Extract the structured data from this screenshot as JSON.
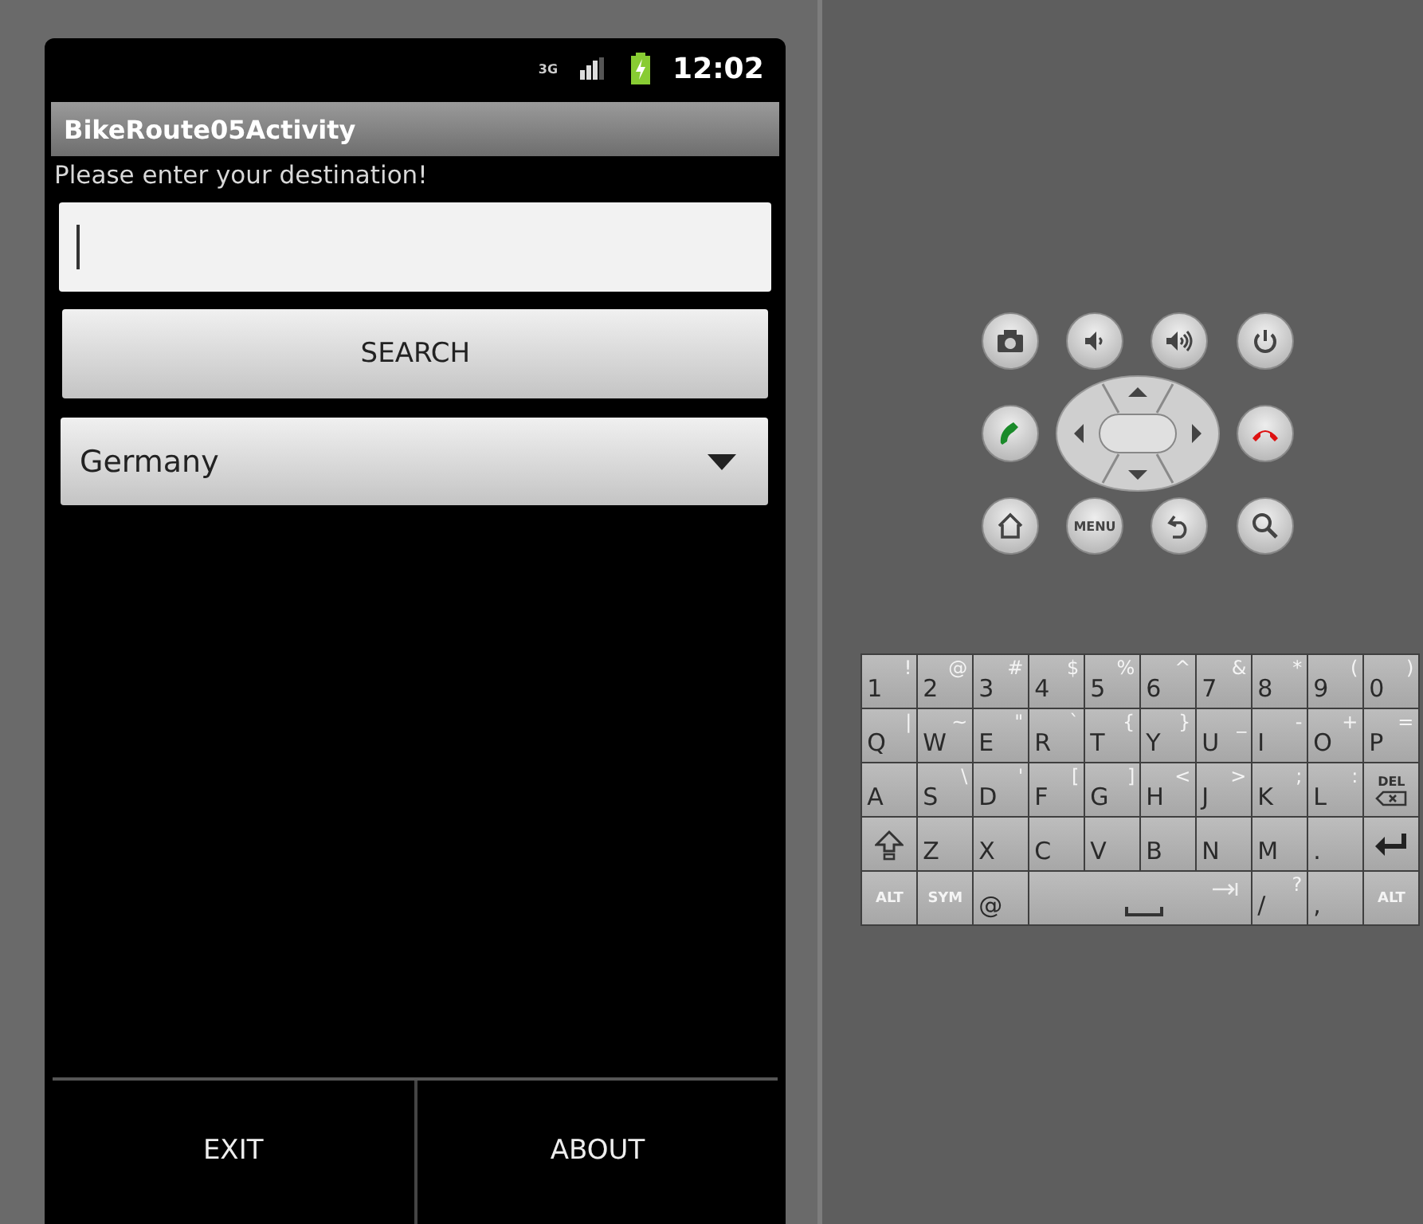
{
  "status_bar": {
    "network": "3G",
    "time": "12:02"
  },
  "app": {
    "title": "BikeRoute05Activity",
    "prompt": "Please enter your destination!",
    "destination_field": {
      "focused": true
    },
    "search_button": "SEARCH",
    "country_spinner": {
      "value": "Germany"
    }
  },
  "options_menu": [
    "EXIT",
    "ABOUT"
  ],
  "device_buttons": [
    [
      {
        "kind": "camera"
      },
      {
        "kind": "volume-down"
      },
      {
        "kind": "volume-up"
      },
      {
        "kind": "power"
      }
    ],
    [
      {
        "kind": "call"
      },
      {
        "kind": "dpad"
      },
      {
        "kind": "end-call"
      }
    ],
    [
      {
        "kind": "home"
      },
      {
        "kind": "menu",
        "label": "MENU"
      },
      {
        "kind": "back"
      },
      {
        "kind": "search"
      }
    ]
  ],
  "keyboard": [
    [
      {
        "kind": "char",
        "label": "1",
        "alt": "!"
      },
      {
        "kind": "char",
        "label": "2",
        "alt": "@"
      },
      {
        "kind": "char",
        "label": "3",
        "alt": "#"
      },
      {
        "kind": "char",
        "label": "4",
        "alt": "$"
      },
      {
        "kind": "char",
        "label": "5",
        "alt": "%"
      },
      {
        "kind": "char",
        "label": "6",
        "alt": "^"
      },
      {
        "kind": "char",
        "label": "7",
        "alt": "&"
      },
      {
        "kind": "char",
        "label": "8",
        "alt": "*"
      },
      {
        "kind": "char",
        "label": "9",
        "alt": "("
      },
      {
        "kind": "char",
        "label": "0",
        "alt": ")"
      }
    ],
    [
      {
        "kind": "char",
        "label": "Q",
        "alt": "|"
      },
      {
        "kind": "char",
        "label": "W",
        "alt": "~"
      },
      {
        "kind": "char",
        "label": "E",
        "alt": "\""
      },
      {
        "kind": "char",
        "label": "R",
        "alt": "`"
      },
      {
        "kind": "char",
        "label": "T",
        "alt": "{"
      },
      {
        "kind": "char",
        "label": "Y",
        "alt": "}"
      },
      {
        "kind": "char",
        "label": "U",
        "alt": "_"
      },
      {
        "kind": "char",
        "label": "I",
        "alt": "-"
      },
      {
        "kind": "char",
        "label": "O",
        "alt": "+"
      },
      {
        "kind": "char",
        "label": "P",
        "alt": "="
      }
    ],
    [
      {
        "kind": "char",
        "label": "A"
      },
      {
        "kind": "char",
        "label": "S",
        "alt": "\\"
      },
      {
        "kind": "char",
        "label": "D",
        "alt": "'"
      },
      {
        "kind": "char",
        "label": "F",
        "alt": "["
      },
      {
        "kind": "char",
        "label": "G",
        "alt": "]"
      },
      {
        "kind": "char",
        "label": "H",
        "alt": "<"
      },
      {
        "kind": "char",
        "label": "J",
        "alt": ">"
      },
      {
        "kind": "char",
        "label": "K",
        "alt": ";"
      },
      {
        "kind": "char",
        "label": "L",
        "alt": ":"
      },
      {
        "kind": "del",
        "label": "DEL"
      }
    ],
    [
      {
        "kind": "shift"
      },
      {
        "kind": "char",
        "label": "Z"
      },
      {
        "kind": "char",
        "label": "X"
      },
      {
        "kind": "char",
        "label": "C"
      },
      {
        "kind": "char",
        "label": "V"
      },
      {
        "kind": "char",
        "label": "B"
      },
      {
        "kind": "char",
        "label": "N"
      },
      {
        "kind": "char",
        "label": "M"
      },
      {
        "kind": "char",
        "label": "."
      },
      {
        "kind": "enter"
      }
    ],
    [
      {
        "kind": "mod",
        "label": "ALT"
      },
      {
        "kind": "mod",
        "label": "SYM"
      },
      {
        "kind": "char",
        "label": "@"
      },
      {
        "kind": "space"
      },
      {
        "kind": "char",
        "label": "/",
        "alt": "?"
      },
      {
        "kind": "char",
        "label": ","
      },
      {
        "kind": "mod",
        "label": "ALT"
      }
    ]
  ]
}
